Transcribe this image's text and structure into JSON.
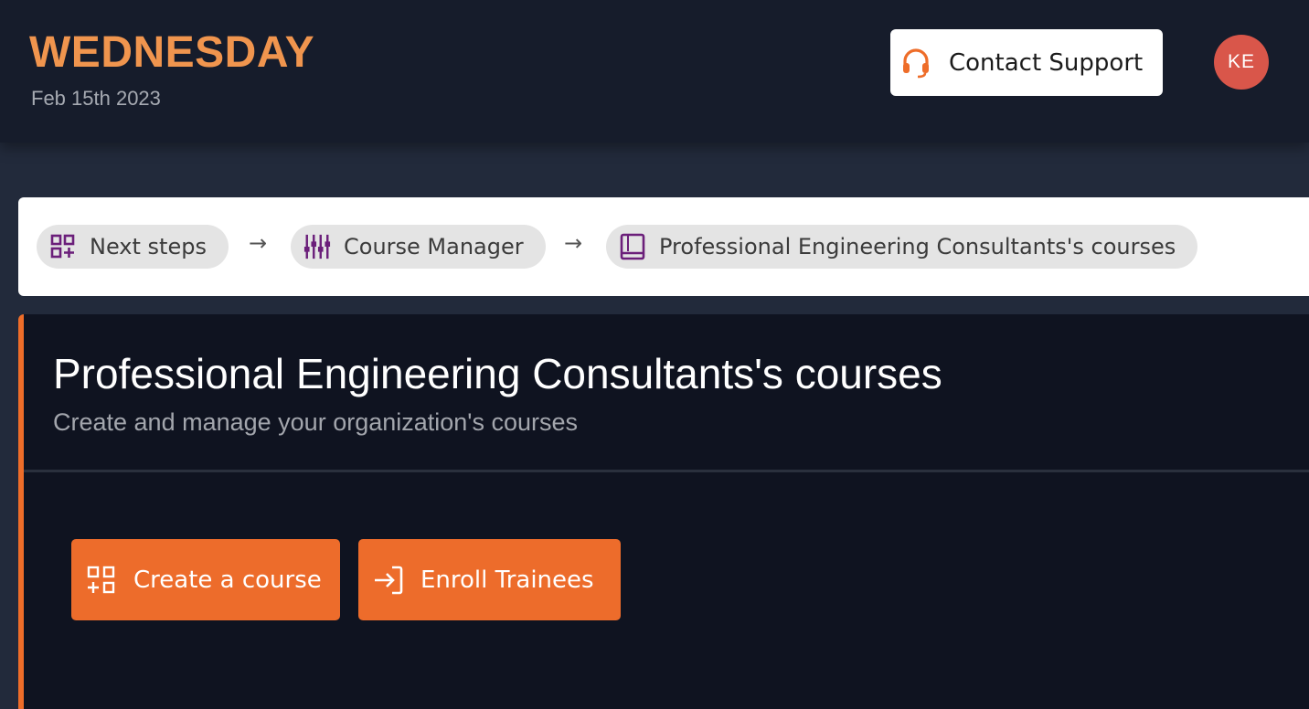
{
  "header": {
    "day": "WEDNESDAY",
    "date": "Feb 15th 2023",
    "support_button": {
      "label": "Contact Support",
      "icon": "headset-icon"
    },
    "avatar_initials": "KE"
  },
  "breadcrumb": {
    "items": [
      {
        "label": "Next steps",
        "icon": "grid-plus-icon"
      },
      {
        "label": "Course Manager",
        "icon": "sliders-icon"
      },
      {
        "label": "Professional Engineering Consultants's courses",
        "icon": "book-icon"
      }
    ],
    "separator": "→"
  },
  "main": {
    "title": "Professional Engineering Consultants's courses",
    "subtitle": "Create and manage your organization's courses",
    "actions": [
      {
        "label": "Create a course",
        "icon": "grid-plus-icon"
      },
      {
        "label": "Enroll Trainees",
        "icon": "enroll-icon"
      }
    ]
  },
  "colors": {
    "accent_orange": "#ed6c2b",
    "day_orange": "#f0954e",
    "breadcrumb_icon_purple": "#6b1f7a",
    "avatar_red": "#d9564a",
    "topbar_bg": "#161c2b",
    "panel_bg": "#0f1320"
  }
}
